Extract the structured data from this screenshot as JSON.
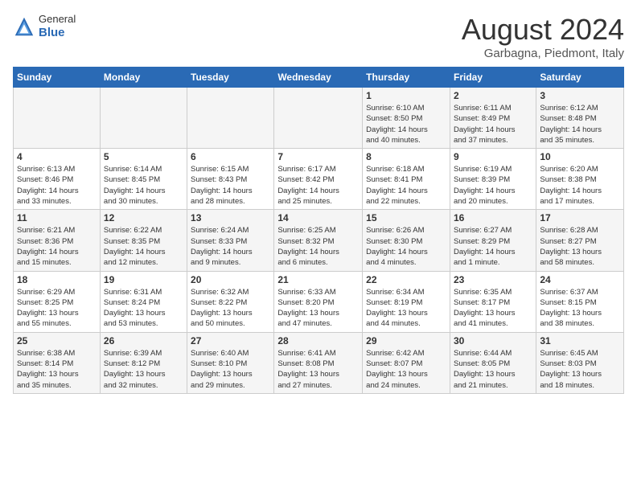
{
  "logo": {
    "general": "General",
    "blue": "Blue"
  },
  "title": {
    "month_year": "August 2024",
    "location": "Garbagna, Piedmont, Italy"
  },
  "weekdays": [
    "Sunday",
    "Monday",
    "Tuesday",
    "Wednesday",
    "Thursday",
    "Friday",
    "Saturday"
  ],
  "weeks": [
    [
      {
        "day": "",
        "info": ""
      },
      {
        "day": "",
        "info": ""
      },
      {
        "day": "",
        "info": ""
      },
      {
        "day": "",
        "info": ""
      },
      {
        "day": "1",
        "info": "Sunrise: 6:10 AM\nSunset: 8:50 PM\nDaylight: 14 hours\nand 40 minutes."
      },
      {
        "day": "2",
        "info": "Sunrise: 6:11 AM\nSunset: 8:49 PM\nDaylight: 14 hours\nand 37 minutes."
      },
      {
        "day": "3",
        "info": "Sunrise: 6:12 AM\nSunset: 8:48 PM\nDaylight: 14 hours\nand 35 minutes."
      }
    ],
    [
      {
        "day": "4",
        "info": "Sunrise: 6:13 AM\nSunset: 8:46 PM\nDaylight: 14 hours\nand 33 minutes."
      },
      {
        "day": "5",
        "info": "Sunrise: 6:14 AM\nSunset: 8:45 PM\nDaylight: 14 hours\nand 30 minutes."
      },
      {
        "day": "6",
        "info": "Sunrise: 6:15 AM\nSunset: 8:43 PM\nDaylight: 14 hours\nand 28 minutes."
      },
      {
        "day": "7",
        "info": "Sunrise: 6:17 AM\nSunset: 8:42 PM\nDaylight: 14 hours\nand 25 minutes."
      },
      {
        "day": "8",
        "info": "Sunrise: 6:18 AM\nSunset: 8:41 PM\nDaylight: 14 hours\nand 22 minutes."
      },
      {
        "day": "9",
        "info": "Sunrise: 6:19 AM\nSunset: 8:39 PM\nDaylight: 14 hours\nand 20 minutes."
      },
      {
        "day": "10",
        "info": "Sunrise: 6:20 AM\nSunset: 8:38 PM\nDaylight: 14 hours\nand 17 minutes."
      }
    ],
    [
      {
        "day": "11",
        "info": "Sunrise: 6:21 AM\nSunset: 8:36 PM\nDaylight: 14 hours\nand 15 minutes."
      },
      {
        "day": "12",
        "info": "Sunrise: 6:22 AM\nSunset: 8:35 PM\nDaylight: 14 hours\nand 12 minutes."
      },
      {
        "day": "13",
        "info": "Sunrise: 6:24 AM\nSunset: 8:33 PM\nDaylight: 14 hours\nand 9 minutes."
      },
      {
        "day": "14",
        "info": "Sunrise: 6:25 AM\nSunset: 8:32 PM\nDaylight: 14 hours\nand 6 minutes."
      },
      {
        "day": "15",
        "info": "Sunrise: 6:26 AM\nSunset: 8:30 PM\nDaylight: 14 hours\nand 4 minutes."
      },
      {
        "day": "16",
        "info": "Sunrise: 6:27 AM\nSunset: 8:29 PM\nDaylight: 14 hours\nand 1 minute."
      },
      {
        "day": "17",
        "info": "Sunrise: 6:28 AM\nSunset: 8:27 PM\nDaylight: 13 hours\nand 58 minutes."
      }
    ],
    [
      {
        "day": "18",
        "info": "Sunrise: 6:29 AM\nSunset: 8:25 PM\nDaylight: 13 hours\nand 55 minutes."
      },
      {
        "day": "19",
        "info": "Sunrise: 6:31 AM\nSunset: 8:24 PM\nDaylight: 13 hours\nand 53 minutes."
      },
      {
        "day": "20",
        "info": "Sunrise: 6:32 AM\nSunset: 8:22 PM\nDaylight: 13 hours\nand 50 minutes."
      },
      {
        "day": "21",
        "info": "Sunrise: 6:33 AM\nSunset: 8:20 PM\nDaylight: 13 hours\nand 47 minutes."
      },
      {
        "day": "22",
        "info": "Sunrise: 6:34 AM\nSunset: 8:19 PM\nDaylight: 13 hours\nand 44 minutes."
      },
      {
        "day": "23",
        "info": "Sunrise: 6:35 AM\nSunset: 8:17 PM\nDaylight: 13 hours\nand 41 minutes."
      },
      {
        "day": "24",
        "info": "Sunrise: 6:37 AM\nSunset: 8:15 PM\nDaylight: 13 hours\nand 38 minutes."
      }
    ],
    [
      {
        "day": "25",
        "info": "Sunrise: 6:38 AM\nSunset: 8:14 PM\nDaylight: 13 hours\nand 35 minutes."
      },
      {
        "day": "26",
        "info": "Sunrise: 6:39 AM\nSunset: 8:12 PM\nDaylight: 13 hours\nand 32 minutes."
      },
      {
        "day": "27",
        "info": "Sunrise: 6:40 AM\nSunset: 8:10 PM\nDaylight: 13 hours\nand 29 minutes."
      },
      {
        "day": "28",
        "info": "Sunrise: 6:41 AM\nSunset: 8:08 PM\nDaylight: 13 hours\nand 27 minutes."
      },
      {
        "day": "29",
        "info": "Sunrise: 6:42 AM\nSunset: 8:07 PM\nDaylight: 13 hours\nand 24 minutes."
      },
      {
        "day": "30",
        "info": "Sunrise: 6:44 AM\nSunset: 8:05 PM\nDaylight: 13 hours\nand 21 minutes."
      },
      {
        "day": "31",
        "info": "Sunrise: 6:45 AM\nSunset: 8:03 PM\nDaylight: 13 hours\nand 18 minutes."
      }
    ]
  ]
}
